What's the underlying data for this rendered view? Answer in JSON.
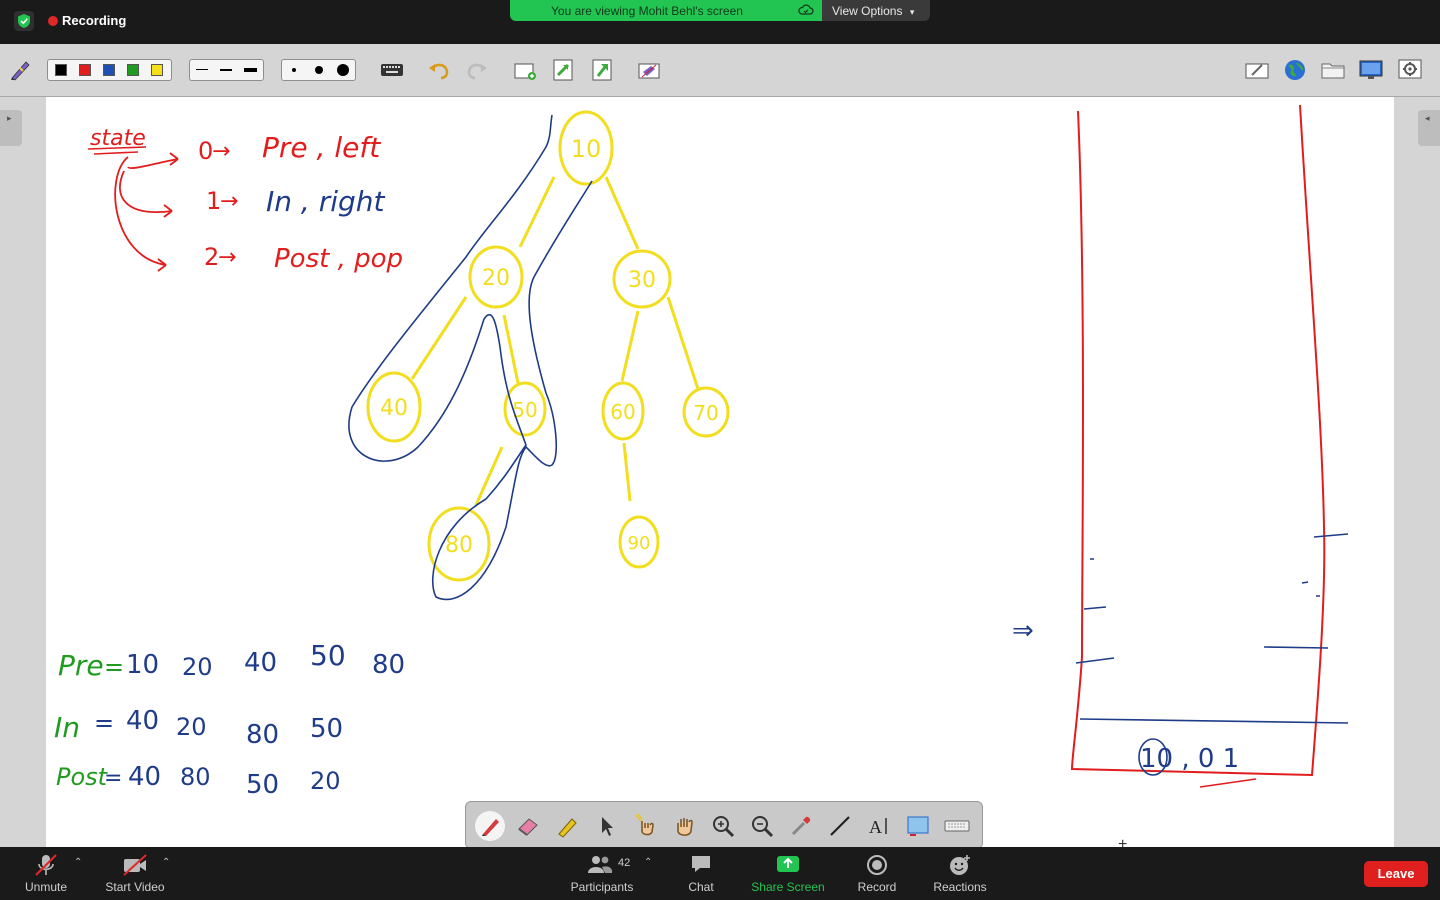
{
  "topbar": {
    "recording_label": "Recording",
    "viewing_text": "You are viewing Mohit Behl's screen",
    "view_options_label": "View Options"
  },
  "toolbar": {
    "colors": [
      "#000000",
      "#e11d1d",
      "#1f4fb5",
      "#1f9b1f",
      "#f5df1a"
    ],
    "pen_widths": [
      "thin",
      "medium",
      "thick"
    ],
    "dot_sizes": [
      "small",
      "medium",
      "large"
    ],
    "icons": [
      "keyboard-icon",
      "undo-icon",
      "redo-icon",
      "new-page-icon",
      "prev-page-icon",
      "next-page-icon",
      "clear-icon",
      "eraser-page-icon",
      "globe-icon",
      "folder-icon",
      "monitor-icon",
      "settings-icon"
    ]
  },
  "whiteboard": {
    "state_title": "state",
    "state_rows": [
      {
        "num": "0",
        "label": "Pre , left"
      },
      {
        "num": "1",
        "label": "In , right"
      },
      {
        "num": "2",
        "label": "Post , pop"
      }
    ],
    "tree_nodes": [
      "10",
      "20",
      "30",
      "40",
      "50",
      "60",
      "70",
      "80",
      "90"
    ],
    "traversals": [
      {
        "name": "Pre",
        "values": [
          "10",
          "20",
          "40",
          "50",
          "80"
        ]
      },
      {
        "name": "In",
        "values": [
          "40",
          "20",
          "80",
          "50"
        ]
      },
      {
        "name": "Post",
        "values": [
          "40",
          "80",
          "50",
          "20"
        ]
      }
    ],
    "stack_entry": "10 , 0 1",
    "arrow_mark": "⇒"
  },
  "annotate_tools": [
    "pen",
    "eraser",
    "highlighter",
    "select",
    "laser",
    "pan",
    "zoom-in",
    "zoom-out",
    "color-picker",
    "line",
    "text",
    "image",
    "keyboard"
  ],
  "bottombar": {
    "unmute_label": "Unmute",
    "start_video_label": "Start Video",
    "participants_label": "Participants",
    "participants_count": "42",
    "chat_label": "Chat",
    "share_screen_label": "Share Screen",
    "record_label": "Record",
    "reactions_label": "Reactions",
    "leave_label": "Leave"
  }
}
